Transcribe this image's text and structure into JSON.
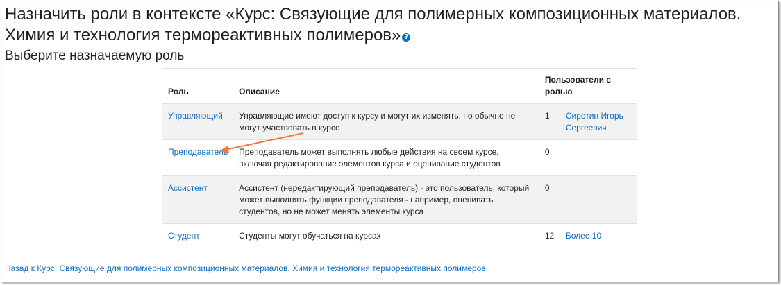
{
  "header": {
    "title": "Назначить роли в контексте «Курс: Связующие для полимерных композиционных материалов. Химия и технология термореактивных полимеров»",
    "help_icon": "question-circle-icon",
    "subtitle": "Выберите назначаемую роль"
  },
  "table": {
    "columns": [
      "Роль",
      "Описание",
      "Пользователи с ролью"
    ],
    "rows": [
      {
        "role": "Управляющий",
        "description": "Управляющие имеют доступ к курсу и могут их изменять, но обычно не могут участвовать в курсе",
        "count": "1",
        "users": "Сиротин Игорь Сергеевич"
      },
      {
        "role": "Преподаватель",
        "description": "Преподаватель может выполнять любые действия на своем курсе, включая редактирование элементов курса и оценивание студентов",
        "count": "0",
        "users": ""
      },
      {
        "role": "Ассистент",
        "description": "Ассистент (нередактирующий преподаватель) - это пользователь, который может выполнять функции преподавателя - например, оценивать студентов, но не может менять элементы курса",
        "count": "0",
        "users": ""
      },
      {
        "role": "Студент",
        "description": "Студенты могут обучаться на курсах",
        "count": "12",
        "users": "Более 10"
      }
    ]
  },
  "footer": {
    "back_link": "Назад к Курс: Связующие для полимерных композиционных материалов. Химия и технология термореактивных полимеров"
  },
  "colors": {
    "link": "#0f6cbf",
    "stripe": "#f2f2f2",
    "annotation_arrow": "#f07b3a"
  }
}
